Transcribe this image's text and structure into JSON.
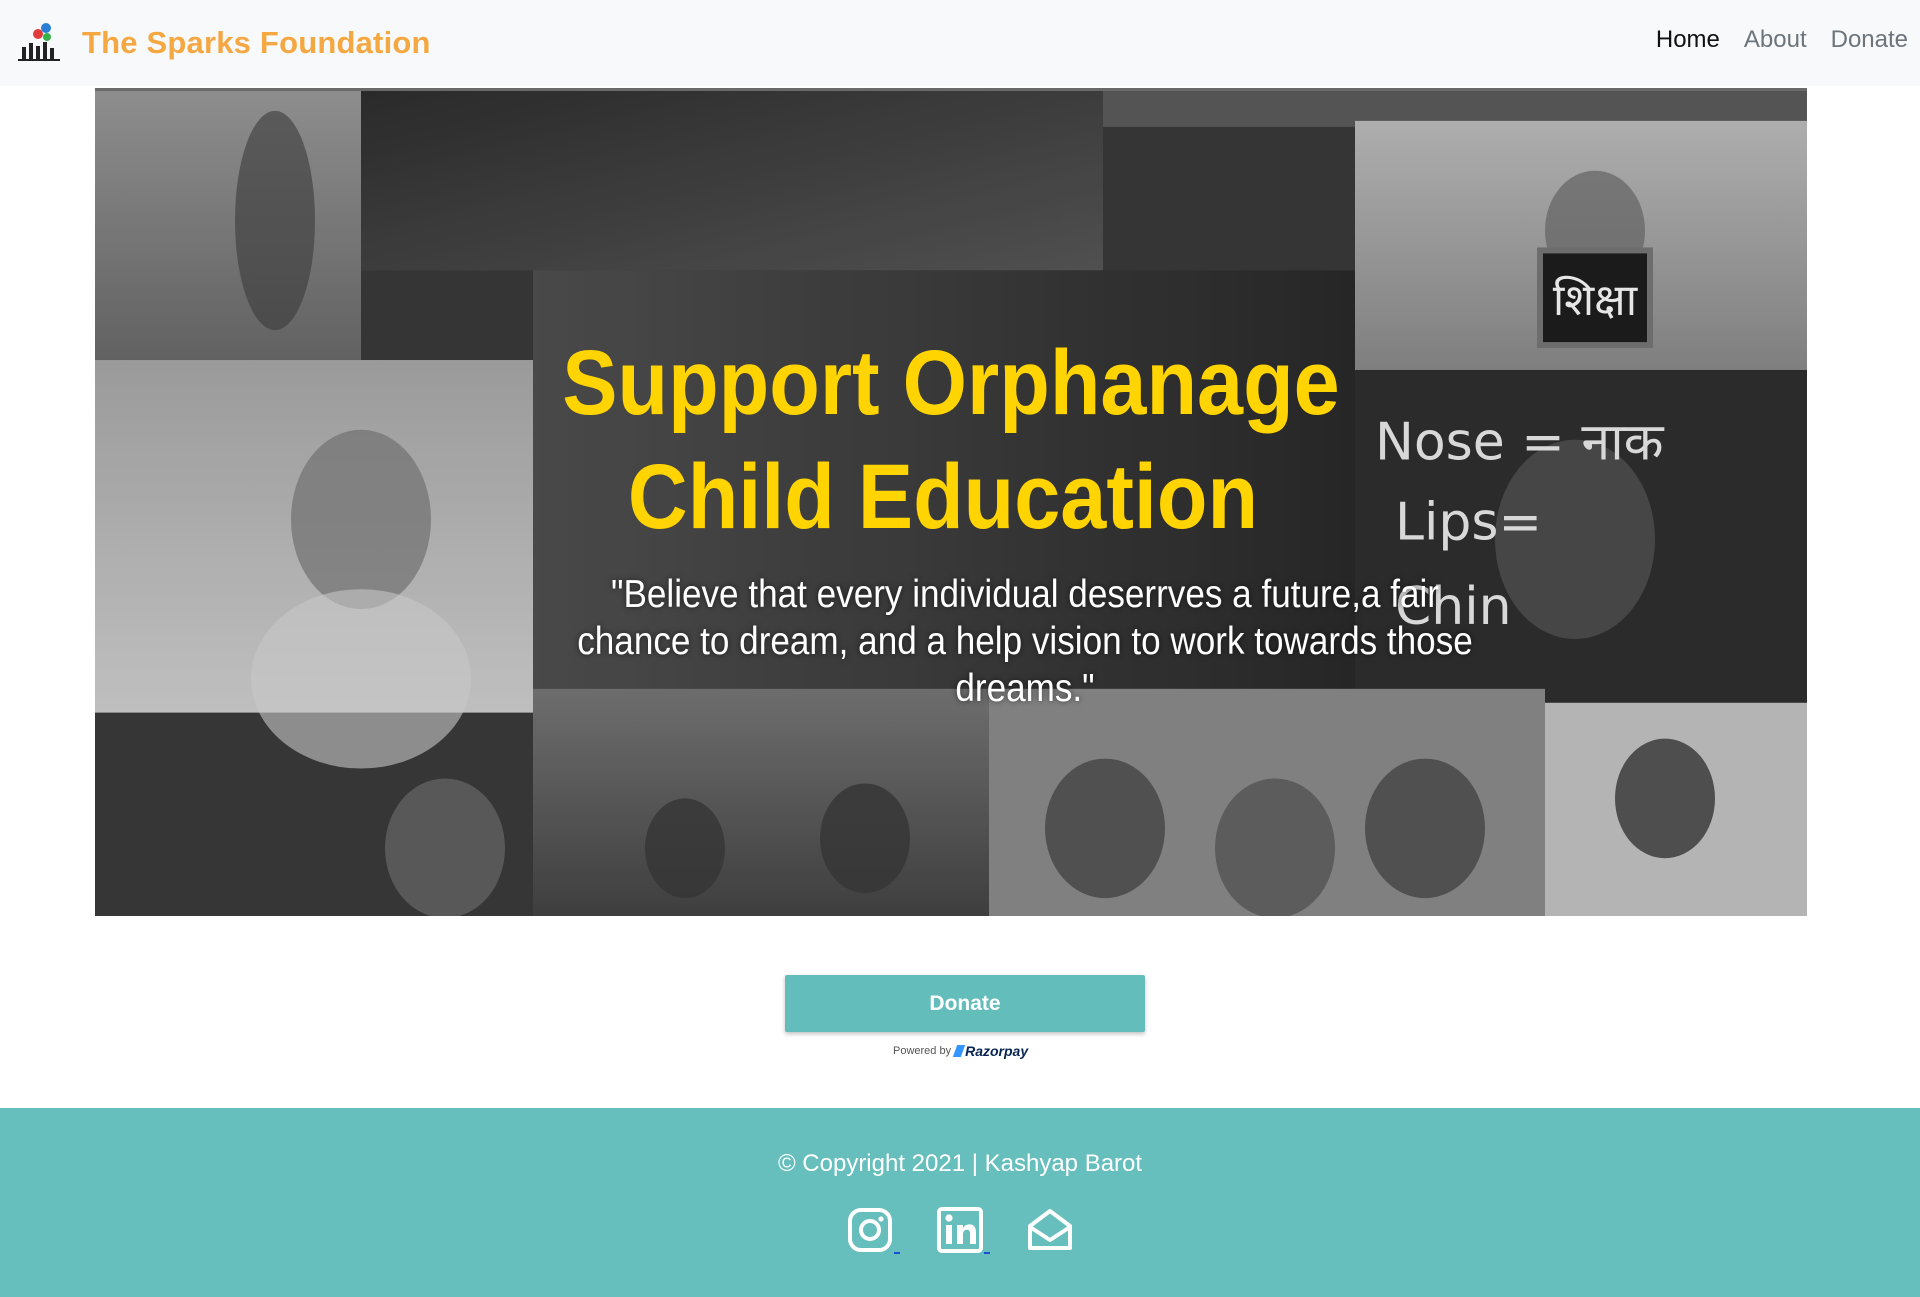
{
  "navbar": {
    "brand": "The Sparks Foundation",
    "links": [
      {
        "label": "Home",
        "active": true
      },
      {
        "label": "About",
        "active": false
      },
      {
        "label": "Donate",
        "active": false
      }
    ]
  },
  "hero": {
    "title_line1": "Support Orphanage",
    "title_line2": "Child Education",
    "quote": "\"Believe that every individual deserrves a future,a fair chance to dream, and a help vision to work towards those dreams.\"",
    "chalkboard_text_1": "शिक्षा",
    "chalkboard_text_2": "Nose = नाक",
    "chalkboard_text_3": "Lips=",
    "chalkboard_text_4": "Chin"
  },
  "donate": {
    "button_label": "Donate",
    "powered_by": "Powered by",
    "provider": "Razorpay"
  },
  "footer": {
    "copyright": "© Copyright 2021 | Kashyap Barot",
    "social": [
      "instagram-icon",
      "linkedin-icon",
      "mail-icon"
    ]
  },
  "colors": {
    "brand": "#f5a742",
    "hero_title": "#ffd400",
    "accent": "#63bdba",
    "footer_bg": "#66bfbd",
    "navbar_bg": "#f8f9fa"
  }
}
